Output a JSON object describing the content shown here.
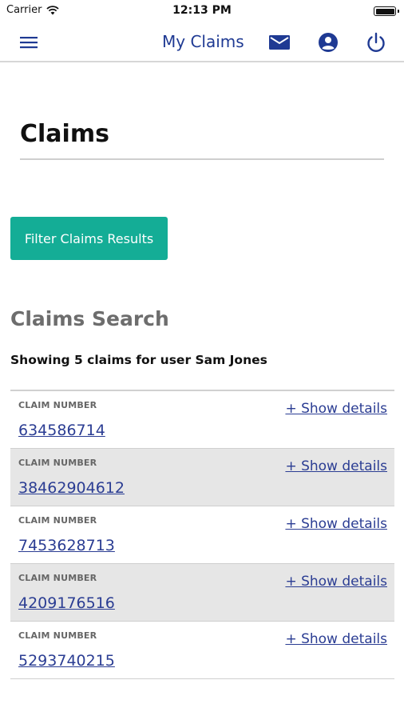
{
  "status_bar": {
    "carrier": "Carrier",
    "time": "12:13 PM"
  },
  "nav": {
    "title": "My Claims",
    "icons": [
      "menu-icon",
      "mail-icon",
      "account-icon",
      "power-icon"
    ]
  },
  "colors": {
    "brand": "#1f3a93",
    "accent": "#14ad96",
    "link": "#2b3d93"
  },
  "page": {
    "title": "Claims"
  },
  "filter": {
    "button_label": "Filter Claims Results"
  },
  "search": {
    "heading": "Claims Search",
    "summary": "Showing 5 claims for user Sam Jones"
  },
  "claims": [
    {
      "label": "CLAIM NUMBER",
      "number": "634586714",
      "details_link": "+ Show details"
    },
    {
      "label": "CLAIM NUMBER",
      "number": "38462904612",
      "details_link": "+ Show details"
    },
    {
      "label": "CLAIM NUMBER",
      "number": "7453628713",
      "details_link": "+ Show details"
    },
    {
      "label": "CLAIM NUMBER",
      "number": "4209176516",
      "details_link": "+ Show details"
    },
    {
      "label": "CLAIM NUMBER",
      "number": "5293740215",
      "details_link": "+ Show details"
    }
  ]
}
